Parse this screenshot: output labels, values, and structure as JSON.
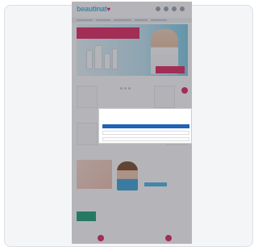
{
  "site": {
    "logo_text": "beautinat",
    "logo_symbol": "♥"
  },
  "hero": {
    "headline": "",
    "badge": ""
  },
  "sections": {
    "products_title": "",
    "brands_title": ""
  },
  "promo": {
    "text": "",
    "button": ""
  },
  "brands": [
    "",
    "",
    "",
    ""
  ],
  "consent": {
    "title": "",
    "text": "",
    "accept_label": "",
    "settings_label": "",
    "reject_label": ""
  },
  "colors": {
    "brand_blue": "#4db3e6",
    "brand_pink": "#e0245e",
    "consent_primary": "#1f62b8",
    "overlay": "#3c3c46"
  },
  "icons": [
    "search-icon",
    "user-icon",
    "heart-icon",
    "cart-icon"
  ]
}
